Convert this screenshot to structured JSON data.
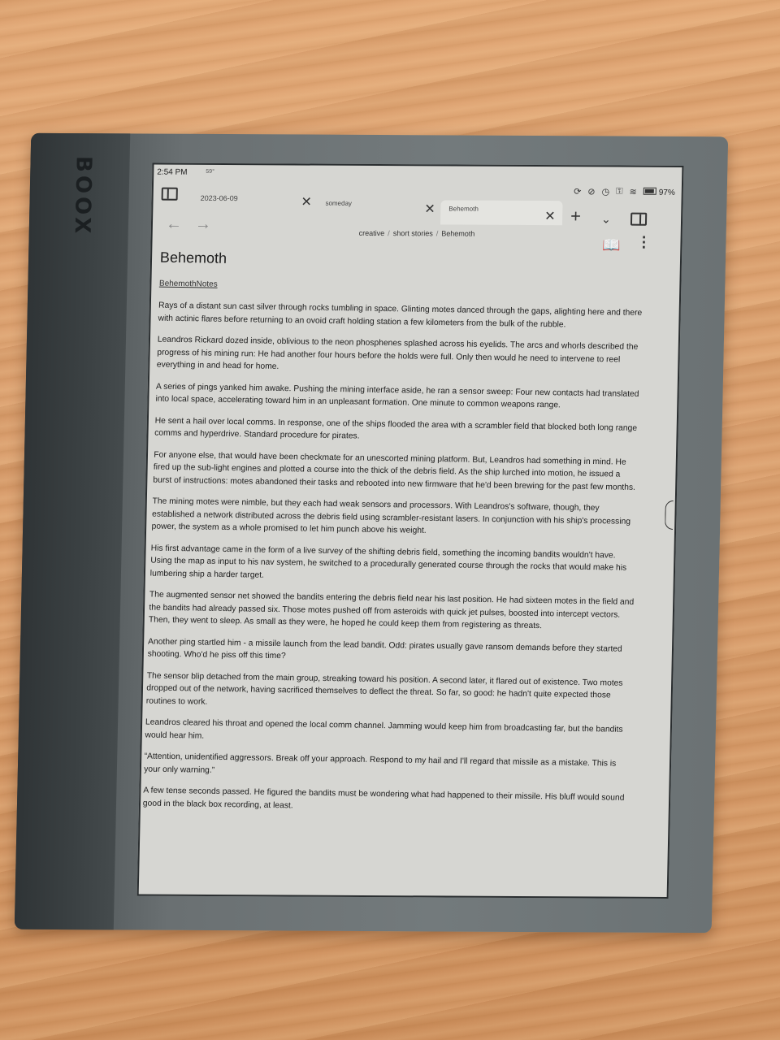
{
  "device": {
    "brand": "BOOX"
  },
  "status_bar": {
    "time": "2:54 PM",
    "small_indicator": "59°",
    "battery": "97%"
  },
  "tabs": [
    {
      "label": "2023-06-09"
    },
    {
      "label": "someday"
    },
    {
      "label": "Behemoth"
    }
  ],
  "breadcrumb": [
    "creative",
    "short stories",
    "Behemoth"
  ],
  "breadcrumb_sep": "/",
  "document": {
    "title": "Behemoth",
    "link": "BehemothNotes",
    "paragraphs": [
      "Rays of a distant sun cast silver through rocks tumbling in space. Glinting motes danced through the gaps, alighting here and there with actinic flares before returning to an ovoid craft holding station a few kilometers from the bulk of the rubble.",
      "Leandros Rickard dozed inside, oblivious to the neon phosphenes splashed across his eyelids. The arcs and whorls described the progress of his mining run: He had another four hours before the holds were full. Only then would he need to intervene to reel everything in and head for home.",
      "A series of pings yanked him awake. Pushing the mining interface aside, he ran a sensor sweep: Four new contacts had translated into local space, accelerating toward him in an unpleasant formation. One minute to common weapons range.",
      "He sent a hail over local comms. In response, one of the ships flooded the area with a scrambler field that blocked both long range comms and hyperdrive. Standard procedure for pirates.",
      "For anyone else, that would have been checkmate for an unescorted mining platform. But, Leandros had something in mind. He fired up the sub-light engines and plotted a course into the thick of the debris field. As the ship lurched into motion, he issued a burst of instructions: motes abandoned their tasks and rebooted into new firmware that he'd been brewing for the past few months.",
      "The mining motes were nimble, but they each had weak sensors and processors. With Leandros's software, though, they established a network distributed across the debris field using scrambler-resistant lasers. In conjunction with his ship's processing power, the system as a whole promised to let him punch above his weight.",
      "His first advantage came in the form of a live survey of the shifting debris field, something the incoming bandits wouldn't have. Using the map as input to his nav system, he switched to a procedurally generated course through the rocks that would make his lumbering ship a harder target.",
      "The augmented sensor net showed the bandits entering the debris field near his last position. He had sixteen motes in the field and the bandits had already passed six. Those motes pushed off from asteroids with quick jet pulses, boosted into intercept vectors. Then, they went to sleep. As small as they were, he hoped he could keep them from registering as threats.",
      "Another ping startled him - a missile launch from the lead bandit. Odd: pirates usually gave ransom demands before they started shooting. Who'd he piss off this time?",
      "The sensor blip detached from the main group, streaking toward his position. A second later, it flared out of existence. Two motes dropped out of the network, having sacrificed themselves to deflect the threat. So far, so good: he hadn't quite expected those routines to work.",
      "Leandros cleared his throat and opened the local comm channel. Jamming would keep him from broadcasting far, but the bandits would hear him.",
      "“Attention, unidentified aggressors. Break off your approach. Respond to my hail and I'll regard that missile as a mistake. This is your only warning.”",
      "A few tense seconds passed. He figured the bandits must be wondering what had happened to their missile. His bluff would sound good in the black box recording, at least."
    ]
  },
  "icons": {
    "left_sidebar": "sidebar-toggle-icon",
    "back": "back-arrow-icon",
    "forward": "forward-arrow-icon",
    "new_tab": "plus-icon",
    "tab_list": "chevron-down-icon",
    "right_sidebar": "right-sidebar-icon",
    "reading_mode": "book-icon",
    "more": "more-vertical-icon",
    "close": "close-icon"
  }
}
